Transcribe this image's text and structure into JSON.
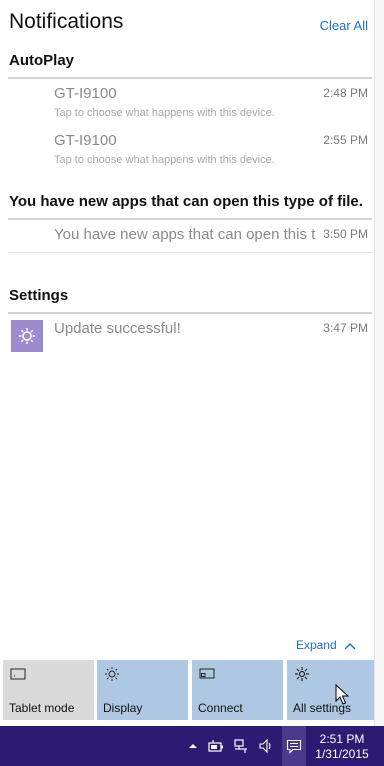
{
  "header": {
    "title": "Notifications",
    "clear_all": "Clear All"
  },
  "groups": [
    {
      "name": "AutoPlay",
      "items": [
        {
          "title": "GT-I9100",
          "subtitle": "Tap to choose what happens with this device.",
          "time": "2:48 PM"
        },
        {
          "title": "GT-I9100",
          "subtitle": "Tap to choose what happens with this device.",
          "time": "2:55 PM"
        }
      ]
    },
    {
      "name": "You have new apps that can open this type of file.",
      "items": [
        {
          "title": "You have new apps that can open this t",
          "time": "3:50 PM"
        }
      ]
    },
    {
      "name": "Settings",
      "items": [
        {
          "title": "Update successful!",
          "time": "3:47 PM",
          "icon": "gear-icon",
          "icon_color": "#9b8bcf"
        }
      ]
    }
  ],
  "expand": "Expand",
  "quick_actions": [
    {
      "label": "Tablet mode",
      "icon": "tablet-icon",
      "active": false
    },
    {
      "label": "Display",
      "icon": "brightness-icon",
      "active": true
    },
    {
      "label": "Connect",
      "icon": "connect-icon",
      "active": true
    },
    {
      "label": "All settings",
      "icon": "gear-icon",
      "active": true
    }
  ],
  "taskbar": {
    "time": "2:51 PM",
    "date": "1/31/2015",
    "tray_icons": [
      "chevron-up-icon",
      "power-icon",
      "network-icon",
      "volume-icon",
      "action-center-icon"
    ],
    "color": "#2b1b72"
  },
  "colors": {
    "accent": "#1a6fce",
    "tile_active": "#aec8e4",
    "tile_inactive": "#dadada"
  }
}
